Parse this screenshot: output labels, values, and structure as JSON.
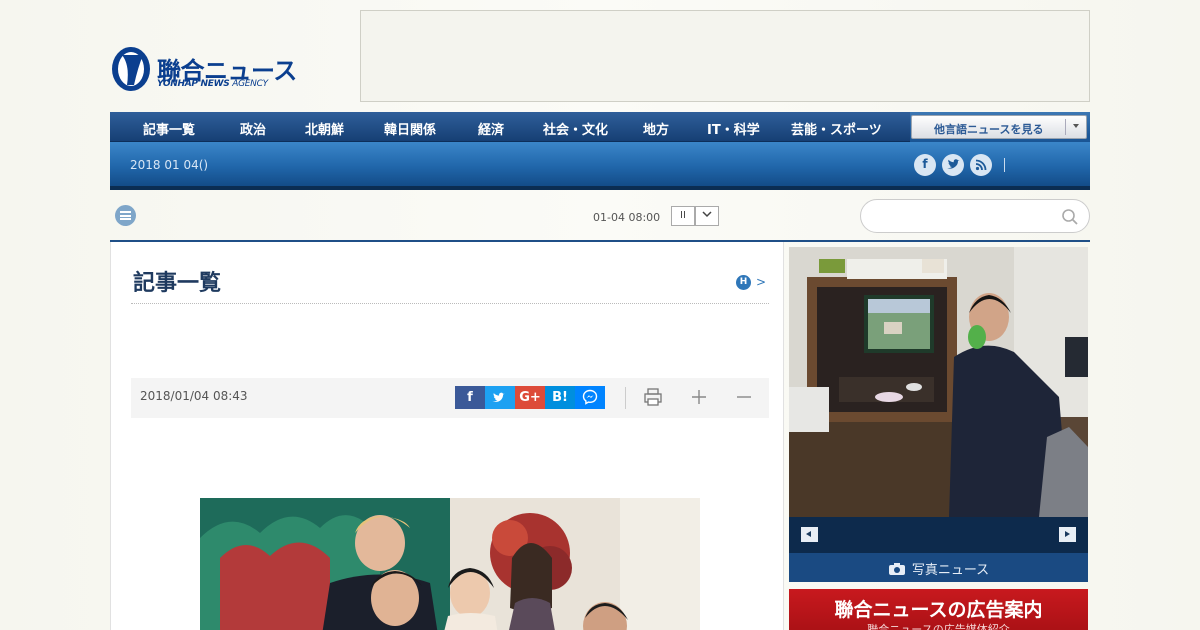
{
  "logo": {
    "title": "聯合ニュース",
    "subtitle_bold": "YONHAP NEWS",
    "subtitle_light": "AGENCY"
  },
  "nav": {
    "items": [
      "記事一覧",
      "政治",
      "北朝鮮",
      "韓日関係",
      "経済",
      "社会・文化",
      "地方",
      "IT・科学",
      "芸能・スポーツ"
    ],
    "language_select": "他言語ニュースを見る",
    "date": "2018 01 04()",
    "social": [
      "f",
      "t",
      "rss"
    ]
  },
  "ticker": {
    "time": "01-04 08:00",
    "pause_label": "II",
    "next_label": "⌄"
  },
  "search": {
    "placeholder": ""
  },
  "content": {
    "title": "記事一覧",
    "badge": "H",
    "badge_arrow": ">",
    "article_time": "2018/01/04 08:43",
    "share_labels": [
      "f",
      "t",
      "G+",
      "B!",
      "m"
    ]
  },
  "sidebar": {
    "photo_news_label": "写真ニュース",
    "ad_title": "聯合ニュースの広告案内",
    "ad_subtitle": "聯合ニュースの広告媒体紹介"
  },
  "colors": {
    "nav_blue": "#1c5898",
    "accent_blue": "#2f77b9",
    "facebook": "#3b5998",
    "twitter": "#1da1f2",
    "gplus": "#dd4b39",
    "hatena": "#008fde",
    "messenger": "#0084ff",
    "ad_red": "#c8191e"
  }
}
